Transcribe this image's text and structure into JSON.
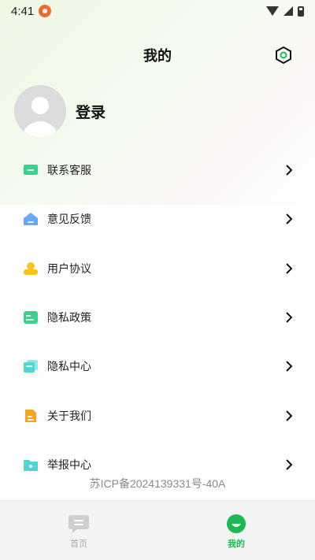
{
  "status_bar": {
    "time": "4:41"
  },
  "header": {
    "title": "我的"
  },
  "profile": {
    "login_label": "登录"
  },
  "menu": {
    "items": [
      {
        "label": "联系客服",
        "icon": "customer-service-icon",
        "color": "#3ccf8e"
      },
      {
        "label": "意见反馈",
        "icon": "feedback-icon",
        "color": "#6aa8f5"
      },
      {
        "label": "用户协议",
        "icon": "user-agreement-icon",
        "color": "#f5c518"
      },
      {
        "label": "隐私政策",
        "icon": "privacy-policy-icon",
        "color": "#3ccf8e"
      },
      {
        "label": "隐私中心",
        "icon": "privacy-center-icon",
        "color": "#4fd6d0"
      },
      {
        "label": "关于我们",
        "icon": "about-us-icon",
        "color": "#f5a524"
      },
      {
        "label": "举报中心",
        "icon": "report-center-icon",
        "color": "#4fd6d0"
      }
    ]
  },
  "footer": {
    "icp": "苏ICP备2024139331号-40A"
  },
  "tabbar": {
    "tabs": [
      {
        "label": "首页",
        "icon": "home-chat-icon",
        "active": false
      },
      {
        "label": "我的",
        "icon": "profile-icon",
        "active": true
      }
    ]
  },
  "colors": {
    "accent": "#1db954",
    "inactive": "#aaaaaa"
  }
}
